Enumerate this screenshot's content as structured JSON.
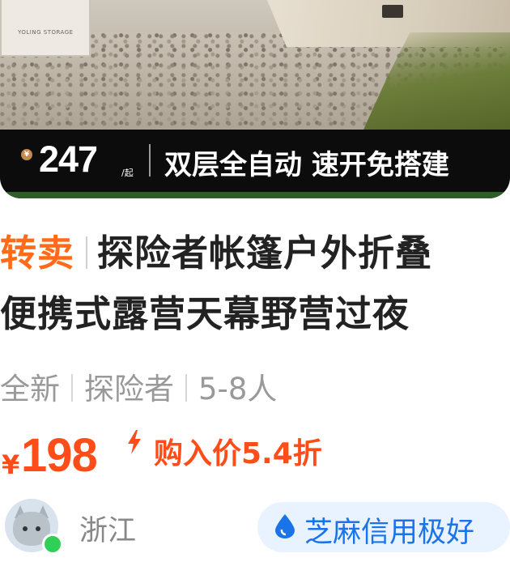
{
  "banner": {
    "currency_symbol": "¥",
    "price": "247",
    "price_unit": "/起",
    "tagline": "双层全自动 速开免搭建",
    "box_label": "YOLING STORAGE"
  },
  "listing": {
    "tag": "转卖",
    "title_line_1": "探险者帐篷户外折叠",
    "title_line_2": "便携式露营天幕野营过夜",
    "condition": "全新",
    "brand": "探险者",
    "capacity": "5-8人"
  },
  "pricing": {
    "currency_symbol": "¥",
    "price": "198",
    "bolt_icon": "lightning-icon",
    "discount_text": "购入价5.4折",
    "accent_color": "#ff4d1a"
  },
  "seller": {
    "location": "浙江",
    "credit_label": "芝麻信用极好",
    "credit_color": "#1a73e8",
    "online": true
  }
}
